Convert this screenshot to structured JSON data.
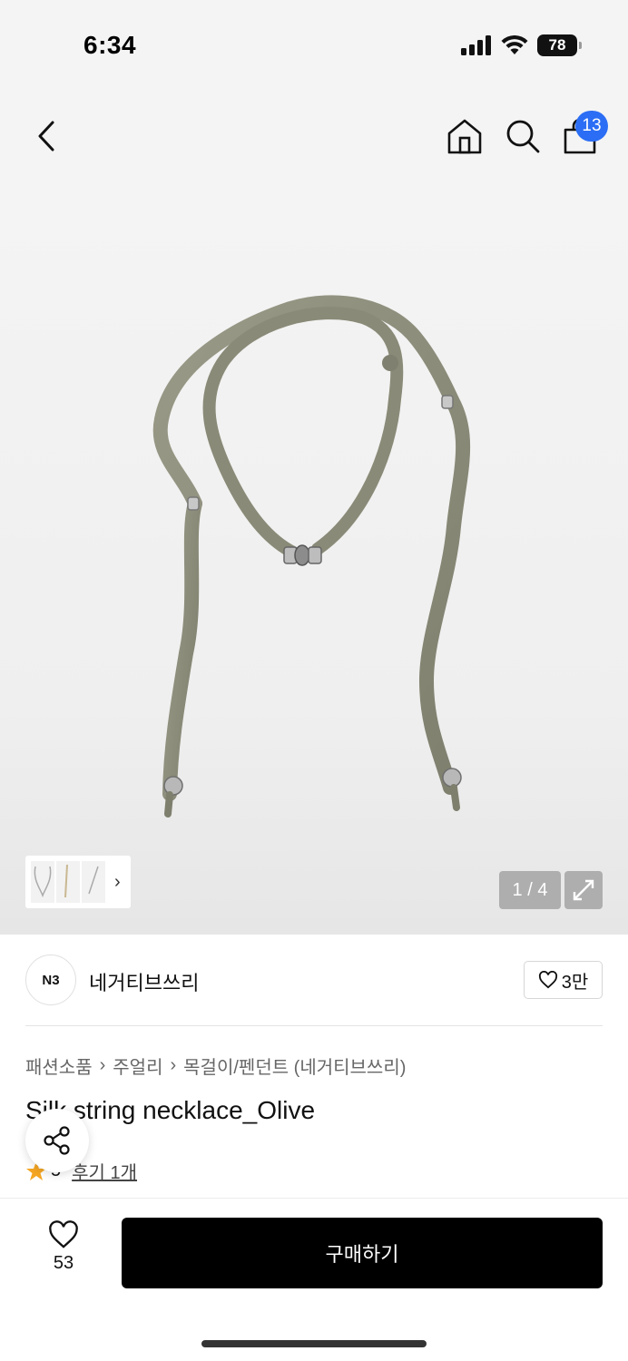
{
  "status_bar": {
    "time": "6:34",
    "battery": "78"
  },
  "nav": {
    "cart_count": "13"
  },
  "gallery": {
    "counter": "1 / 4"
  },
  "brand": {
    "logo_text": "N3",
    "name": "네거티브쓰리",
    "likes": "3만"
  },
  "breadcrumb": {
    "items": [
      "패션소품",
      "주얼리",
      "목걸이/펜던트 (네거티브쓰리)"
    ]
  },
  "product": {
    "title": "Silk string necklace_Olive",
    "rating": "5",
    "review_label": "후기 1개"
  },
  "bottom_bar": {
    "wish_count": "53",
    "buy_label": "구매하기"
  },
  "colors": {
    "accent_badge": "#2b6ef5",
    "star": "#f5a623",
    "buy_button": "#000000",
    "ribbon": "#8f8f7f"
  }
}
